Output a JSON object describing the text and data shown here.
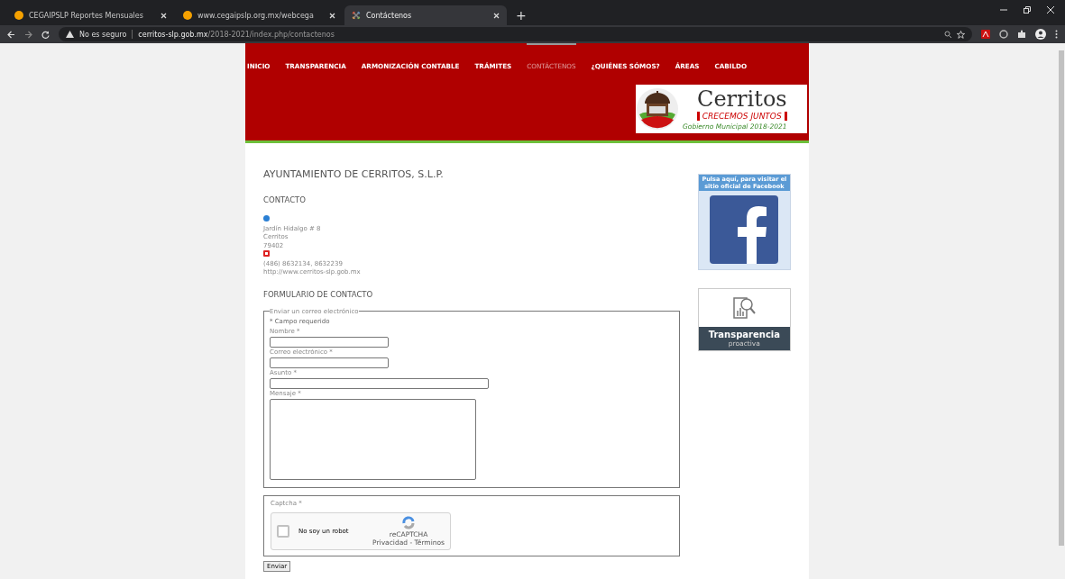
{
  "browser": {
    "tabs": [
      {
        "title": "CEGAIPSLP Reportes Mensuales",
        "selected": false
      },
      {
        "title": "www.cegaipslp.org.mx/webcega",
        "selected": false
      },
      {
        "title": "Contáctenos",
        "selected": true
      }
    ],
    "new_tab": "+",
    "security": "No es seguro",
    "url_host": "cerritos-slp.gob.mx",
    "url_path": "/2018-2021/index.php/contactenos"
  },
  "nav": [
    {
      "label": "INICIO",
      "selected": false
    },
    {
      "label": "TRANSPARENCIA",
      "selected": false
    },
    {
      "label": "ARMONIZACIÓN CONTABLE",
      "selected": false
    },
    {
      "label": "TRÁMITES",
      "selected": false
    },
    {
      "label": "CONTÁCTENOS",
      "selected": true
    },
    {
      "label": "¿QUIÉNES SÓMOS?",
      "selected": false
    },
    {
      "label": "ÁREAS",
      "selected": false
    },
    {
      "label": "CABILDO",
      "selected": false
    }
  ],
  "logo": {
    "name": "Cerritos",
    "slogan": "CRECEMOS JUNTOS",
    "subtitle": "Gobierno Municipal 2018-2021"
  },
  "page_title": "AYUNTAMIENTO DE CERRITOS, S.L.P.",
  "contact": {
    "heading": "CONTACTO",
    "address": [
      "Jardín Hidalgo # 8",
      "Cerritos",
      "79402"
    ],
    "phone": "(486) 8632134, 8632239",
    "website": "http://www.cerritos-slp.gob.mx"
  },
  "form": {
    "heading": "FORMULARIO DE CONTACTO",
    "legend": "Enviar un correo electrónico",
    "required_note": "* Campo requerido",
    "fields": [
      {
        "label": "Nombre *",
        "kind": "short"
      },
      {
        "label": "Correo electrónico *",
        "kind": "short"
      },
      {
        "label": "Asunto *",
        "kind": "long"
      },
      {
        "label": "Mensaje *",
        "kind": "textarea"
      }
    ],
    "captcha": {
      "label": "Captcha *",
      "checkbox_label": "No soy un robot",
      "checked": false,
      "brand": "reCAPTCHA",
      "links": "Privacidad - Términos"
    },
    "submit": "Enviar"
  },
  "sidebar": {
    "facebook_caption": "Pulsa aquí, para visitar el sitio oficial de Facebook",
    "transparency_title": "Transparencia",
    "transparency_subtitle": "proactiva"
  }
}
